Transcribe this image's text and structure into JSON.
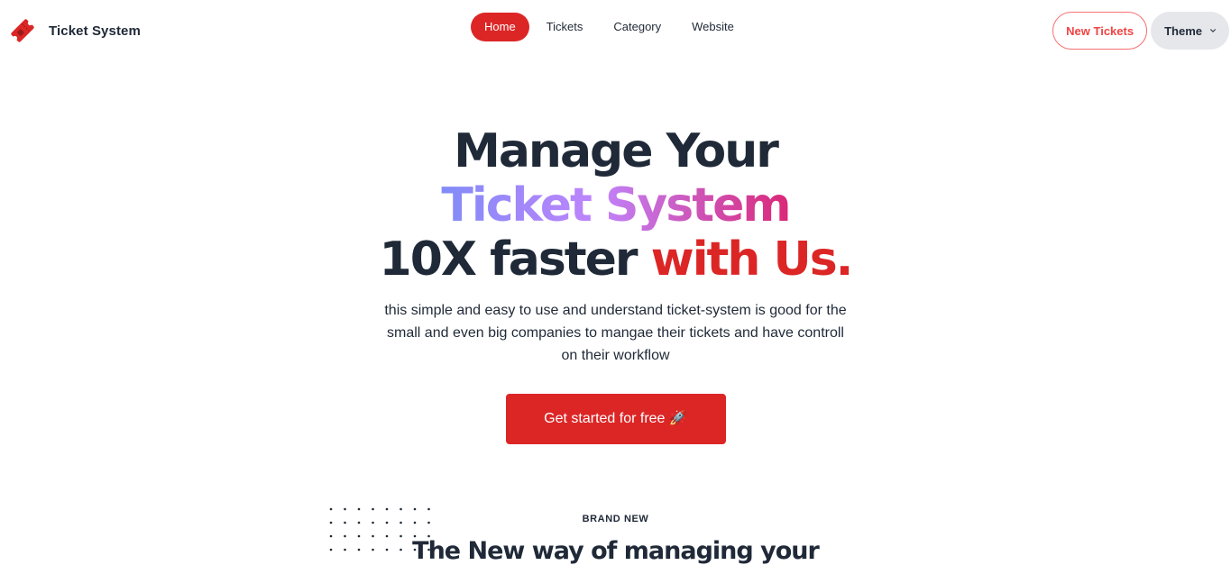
{
  "brand": {
    "name": "Ticket System",
    "logo_icon": "ticket-icon",
    "logo_color": "#dc2626"
  },
  "nav": {
    "links": [
      {
        "label": "Home",
        "active": true
      },
      {
        "label": "Tickets",
        "active": false
      },
      {
        "label": "Category",
        "active": false
      },
      {
        "label": "Website",
        "active": false
      }
    ],
    "new_tickets_label": "New Tickets",
    "theme_label": "Theme"
  },
  "hero": {
    "line1": "Manage Your",
    "line2": "Ticket System",
    "line3_dark": "10X faster",
    "line3_red": "with Us.",
    "description": "this simple and easy to use and understand ticket-system is good for the small and even big companies to mangae their tickets and have controll on their workflow",
    "cta_label": "Get started for free 🚀"
  },
  "section": {
    "kicker": "BRAND NEW",
    "title": "The New way of managing your"
  },
  "colors": {
    "primary": "#dc2626",
    "text": "#1f2937",
    "gradient_start": "#818cf8",
    "gradient_end": "#db2777"
  }
}
